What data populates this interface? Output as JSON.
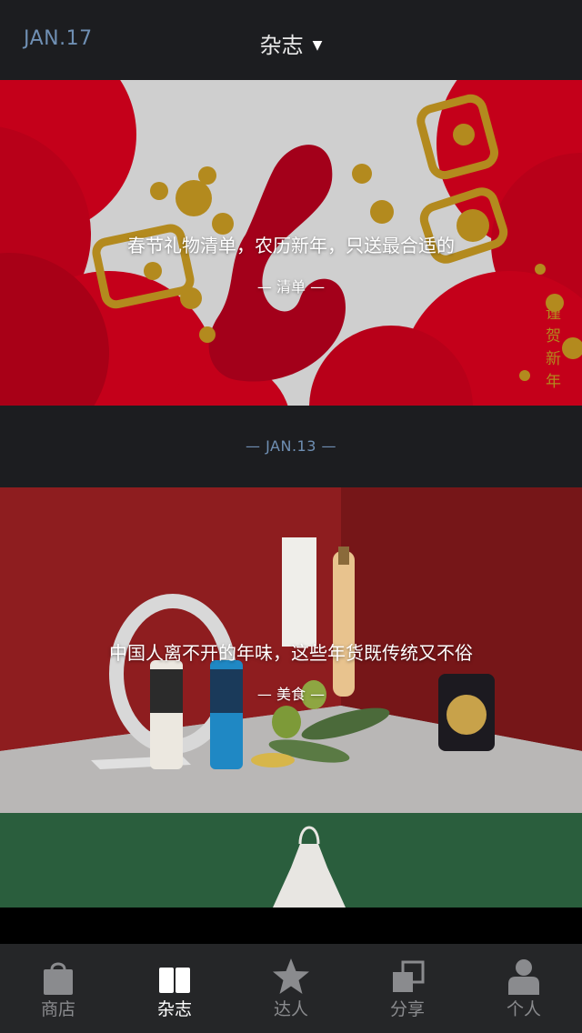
{
  "header": {
    "date": "JAN.17",
    "title": "杂志",
    "dropdown_icon": "caret-down-icon"
  },
  "cards": [
    {
      "title": "春节礼物清单，农历新年，只送最合适的",
      "category": "— 清单 —",
      "side_text": [
        "谨",
        "贺",
        "新",
        "年"
      ],
      "colors": {
        "red": "#c4001a",
        "gold": "#b38a1e"
      }
    },
    {
      "title": "中国人离不开的年味，这些年货既传统又不俗",
      "category": "— 美食 —",
      "colors": {
        "red": "#8e1d1f"
      }
    },
    {
      "colors": {
        "green": "#2a5e3d"
      }
    }
  ],
  "date_separator": "—  JAN.13  —",
  "tabbar": {
    "items": [
      {
        "label": "商店",
        "icon": "shopping-bag-icon",
        "active": false
      },
      {
        "label": "杂志",
        "icon": "book-icon",
        "active": true
      },
      {
        "label": "达人",
        "icon": "star-icon",
        "active": false
      },
      {
        "label": "分享",
        "icon": "share-squares-icon",
        "active": false
      },
      {
        "label": "个人",
        "icon": "person-icon",
        "active": false
      }
    ]
  }
}
